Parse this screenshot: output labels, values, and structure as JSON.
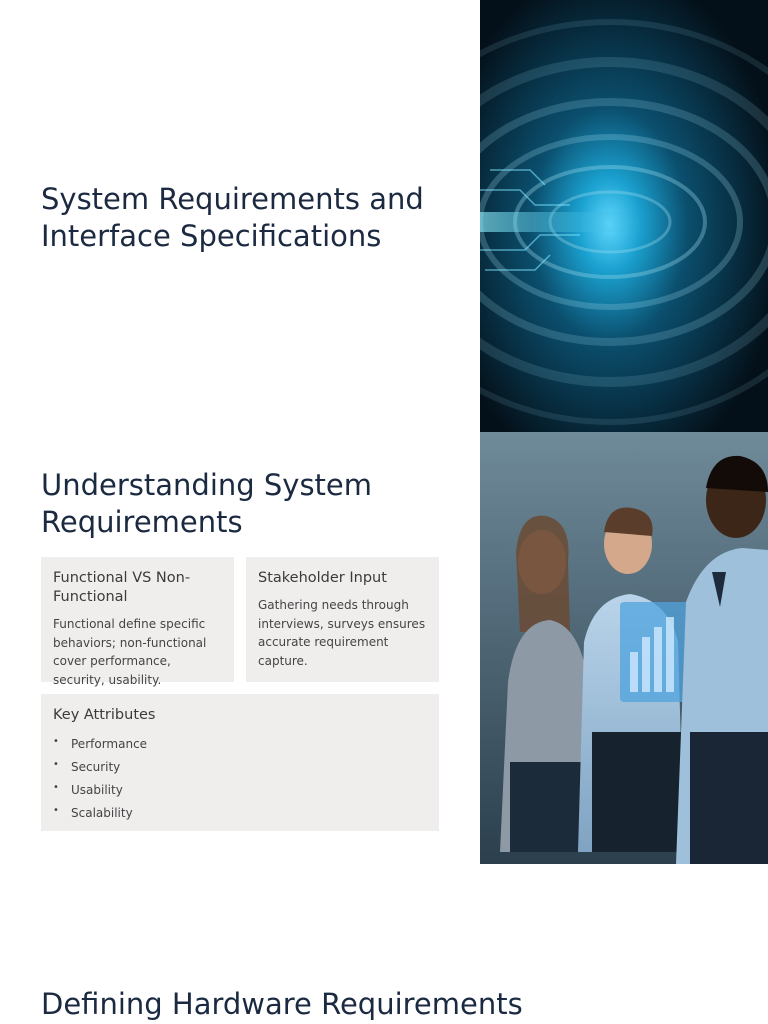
{
  "hero": {
    "title": "System Requirements and Interface Specifications"
  },
  "section": {
    "title": "Understanding System Requirements",
    "cards": {
      "functional": {
        "heading": "Functional VS Non-Functional",
        "body": "Functional define specific behaviors; non-functional cover performance, security, usability."
      },
      "stakeholder": {
        "heading": "Stakeholder Input",
        "body": "Gathering needs through interviews, surveys ensures accurate requirement capture."
      },
      "attributes": {
        "heading": "Key Attributes",
        "items": [
          "Performance",
          "Security",
          "Usability",
          "Scalability"
        ]
      }
    }
  },
  "next_section": {
    "title": "Defining Hardware Requirements"
  },
  "colors": {
    "heading": "#1b2a41",
    "card_background": "#f0eded",
    "body_text": "#444444"
  }
}
